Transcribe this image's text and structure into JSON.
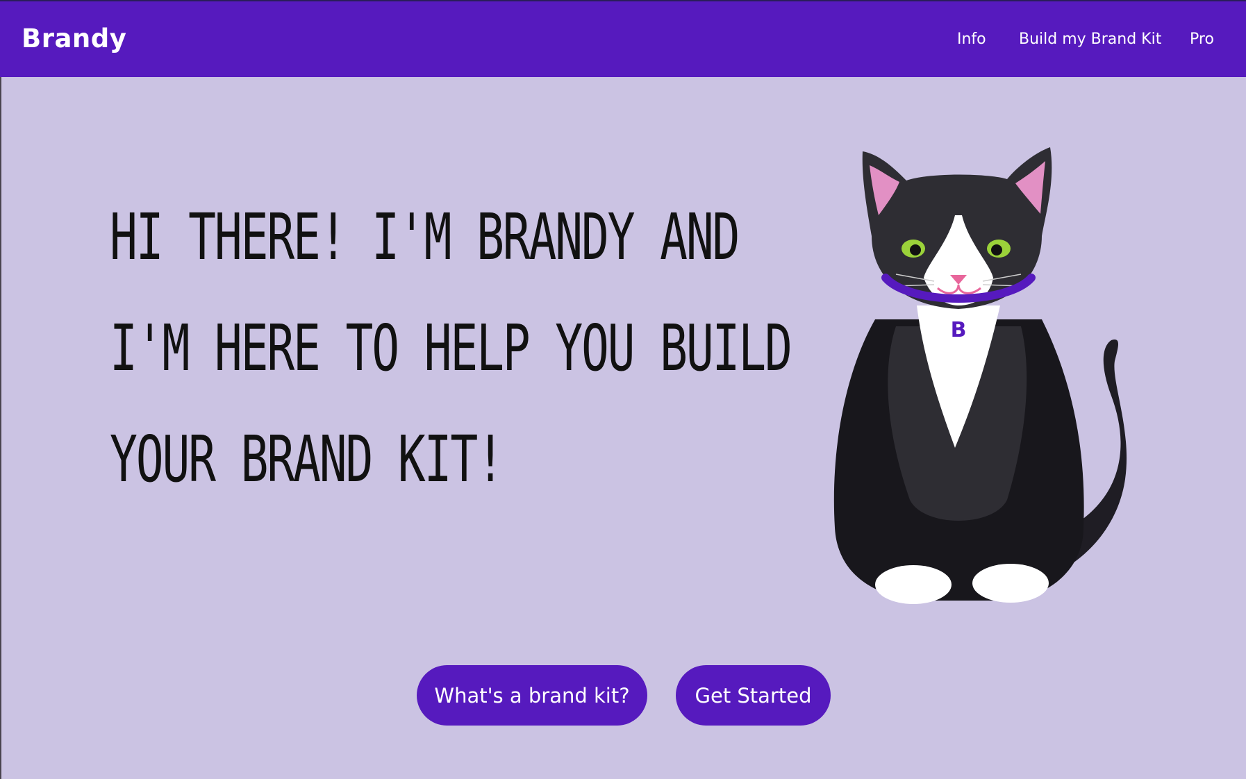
{
  "header": {
    "brand": "Brandy",
    "nav": [
      {
        "label": "Info"
      },
      {
        "label": "Build my Brand Kit"
      },
      {
        "label": "Pro"
      }
    ]
  },
  "hero": {
    "headline_lines": [
      "HI THERE! I'M BRANDY AND",
      "I'M HERE TO HELP YOU BUILD",
      "YOUR BRAND KIT!"
    ],
    "collar_tag_letter": "B"
  },
  "actions": {
    "primary_label": "What's a brand kit?",
    "secondary_label": "Get Started"
  },
  "colors": {
    "accent": "#561abe",
    "background": "#cbc3e3",
    "text": "#111111"
  }
}
